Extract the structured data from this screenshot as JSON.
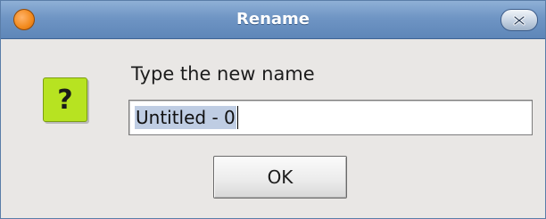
{
  "window": {
    "title": "Rename",
    "app_icon": "app-orb-icon",
    "close_icon": "close-icon"
  },
  "dialog": {
    "icon": "question-icon",
    "icon_glyph": "?",
    "prompt": "Type the new name",
    "input_value": "Untitled - 0",
    "ok_label": "OK"
  },
  "colors": {
    "titlebar": "#6f95c4",
    "window_bg": "#e9e7e5",
    "question_icon_bg": "#b7e321",
    "selection": "#bfcde3"
  }
}
